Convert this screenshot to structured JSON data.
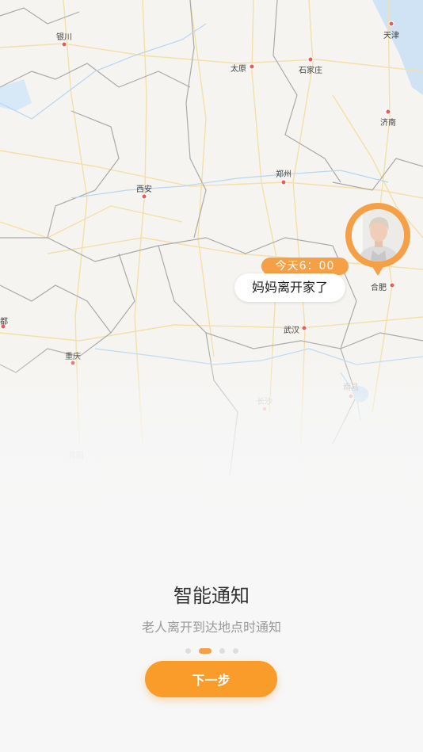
{
  "map": {
    "cities": {
      "yinchuan": "银川",
      "taiyuan": "太原",
      "shijiazhuang": "石家庄",
      "tianjin": "天津",
      "jinan": "济南",
      "zhengzhou": "郑州",
      "xian": "西安",
      "hefei": "合肥",
      "wuhan": "武汉",
      "chengdu": "都",
      "chongqing": "重庆",
      "changsha": "长沙",
      "nanchang": "南昌",
      "guiyang": "贵阳"
    },
    "marker": {
      "time": "今天6：00",
      "message": "妈妈离开家了",
      "color": "#f5a046"
    }
  },
  "onboarding": {
    "title": "智能通知",
    "subtitle": "老人离开到达地点时通知",
    "page_indicator": {
      "total": 4,
      "current": 2
    },
    "next_label": "下一步",
    "accent_color": "#f99c2a"
  }
}
